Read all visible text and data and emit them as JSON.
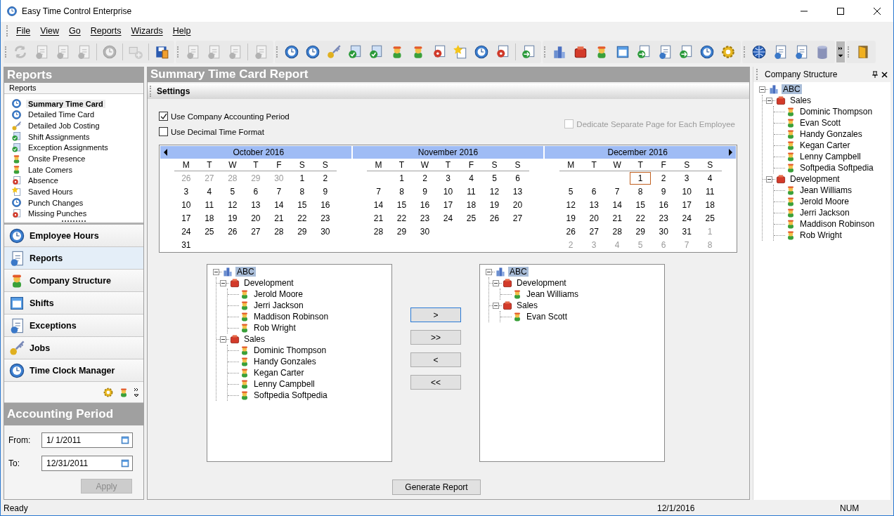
{
  "window": {
    "title": "Easy Time Control Enterprise"
  },
  "menu": [
    "File",
    "View",
    "Go",
    "Reports",
    "Wizards",
    "Help"
  ],
  "toolbar": {
    "groups": [
      {
        "sections": [
          {
            "buttons": [
              {
                "disabled": true
              },
              {
                "disabled": true
              },
              {
                "disabled": true
              },
              {
                "disabled": true
              }
            ]
          },
          {
            "buttons": [
              {
                "disabled": true
              }
            ]
          },
          {
            "buttons": [
              {
                "disabled": true
              }
            ]
          },
          {
            "buttons": [
              {
                "disabled": false
              }
            ]
          }
        ]
      },
      {
        "sections": [
          {
            "buttons": [
              {
                "disabled": true
              },
              {
                "disabled": true
              },
              {
                "disabled": true
              }
            ]
          },
          {
            "buttons": [
              {
                "disabled": true
              }
            ]
          }
        ]
      },
      {
        "sections": [
          {
            "buttons": [
              {
                "disabled": false
              },
              {
                "disabled": false
              },
              {
                "disabled": false
              },
              {
                "disabled": false
              },
              {
                "disabled": false
              },
              {
                "disabled": false
              },
              {
                "disabled": false
              },
              {
                "disabled": false
              },
              {
                "disabled": false
              },
              {
                "disabled": false
              },
              {
                "disabled": false
              }
            ]
          },
          {
            "buttons": [
              {
                "disabled": false
              }
            ]
          }
        ]
      },
      {
        "sections": [
          {
            "buttons": [
              {
                "disabled": false
              },
              {
                "disabled": false
              },
              {
                "disabled": false
              },
              {
                "disabled": false
              },
              {
                "disabled": false
              },
              {
                "disabled": false
              },
              {
                "disabled": false
              },
              {
                "disabled": false
              },
              {
                "disabled": false
              }
            ]
          }
        ]
      },
      {
        "sections": [
          {
            "buttons": [
              {
                "disabled": false
              },
              {
                "disabled": false
              },
              {
                "disabled": false
              },
              {
                "disabled": false
              }
            ]
          }
        ]
      }
    ]
  },
  "left_panel": {
    "title": "Reports",
    "subtitle": "Reports",
    "reports": [
      {
        "label": "Summary Time Card",
        "selected": true
      },
      {
        "label": "Detailed Time Card",
        "selected": false
      },
      {
        "label": "Detailed Job Costing",
        "selected": false
      },
      {
        "label": "Shift Assignments",
        "selected": false
      },
      {
        "label": "Exception Assignments",
        "selected": false
      },
      {
        "label": "Onsite Presence",
        "selected": false
      },
      {
        "label": "Late Comers",
        "selected": false
      },
      {
        "label": "Absence",
        "selected": false
      },
      {
        "label": "Saved Hours",
        "selected": false
      },
      {
        "label": "Punch Changes",
        "selected": false
      },
      {
        "label": "Missing Punches",
        "selected": false
      }
    ],
    "nav": [
      {
        "label": "Employee Hours",
        "selected": false
      },
      {
        "label": "Reports",
        "selected": true
      },
      {
        "label": "Company Structure",
        "selected": false
      },
      {
        "label": "Shifts",
        "selected": false
      },
      {
        "label": "Exceptions",
        "selected": false
      },
      {
        "label": "Jobs",
        "selected": false
      },
      {
        "label": "Time Clock Manager",
        "selected": false
      }
    ],
    "accounting_period": {
      "title": "Accounting Period",
      "from_label": "From:",
      "from": "1/  1/2011",
      "to_label": "To:",
      "to": "12/31/2011",
      "apply": {
        "label": "Apply",
        "disabled": true
      }
    }
  },
  "report": {
    "title": "Summary Time Card Report",
    "section": "Settings",
    "options": [
      {
        "label": "Use Company Accounting Period",
        "checked": true,
        "disabled": false
      },
      {
        "label": "Use Decimal Time Format",
        "checked": false,
        "disabled": false
      },
      {
        "label": "Dedicate Separate Page for Each Employee",
        "checked": false,
        "disabled": true
      }
    ],
    "calendar": [
      {
        "title": "October 2016",
        "weekdays": [
          "M",
          "T",
          "W",
          "T",
          "F",
          "S",
          "S"
        ],
        "weeks": [
          [
            {
              "day": "26",
              "muted": true,
              "today": false
            },
            {
              "day": "27",
              "muted": true,
              "today": false
            },
            {
              "day": "28",
              "muted": true,
              "today": false
            },
            {
              "day": "29",
              "muted": true,
              "today": false
            },
            {
              "day": "30",
              "muted": true,
              "today": false
            },
            {
              "day": "1",
              "muted": false,
              "today": false
            },
            {
              "day": "2",
              "muted": false,
              "today": false
            }
          ],
          [
            {
              "day": "3",
              "muted": false,
              "today": false
            },
            {
              "day": "4",
              "muted": false,
              "today": false
            },
            {
              "day": "5",
              "muted": false,
              "today": false
            },
            {
              "day": "6",
              "muted": false,
              "today": false
            },
            {
              "day": "7",
              "muted": false,
              "today": false
            },
            {
              "day": "8",
              "muted": false,
              "today": false
            },
            {
              "day": "9",
              "muted": false,
              "today": false
            }
          ],
          [
            {
              "day": "10",
              "muted": false,
              "today": false
            },
            {
              "day": "11",
              "muted": false,
              "today": false
            },
            {
              "day": "12",
              "muted": false,
              "today": false
            },
            {
              "day": "13",
              "muted": false,
              "today": false
            },
            {
              "day": "14",
              "muted": false,
              "today": false
            },
            {
              "day": "15",
              "muted": false,
              "today": false
            },
            {
              "day": "16",
              "muted": false,
              "today": false
            }
          ],
          [
            {
              "day": "17",
              "muted": false,
              "today": false
            },
            {
              "day": "18",
              "muted": false,
              "today": false
            },
            {
              "day": "19",
              "muted": false,
              "today": false
            },
            {
              "day": "20",
              "muted": false,
              "today": false
            },
            {
              "day": "21",
              "muted": false,
              "today": false
            },
            {
              "day": "22",
              "muted": false,
              "today": false
            },
            {
              "day": "23",
              "muted": false,
              "today": false
            }
          ],
          [
            {
              "day": "24",
              "muted": false,
              "today": false
            },
            {
              "day": "25",
              "muted": false,
              "today": false
            },
            {
              "day": "26",
              "muted": false,
              "today": false
            },
            {
              "day": "27",
              "muted": false,
              "today": false
            },
            {
              "day": "28",
              "muted": false,
              "today": false
            },
            {
              "day": "29",
              "muted": false,
              "today": false
            },
            {
              "day": "30",
              "muted": false,
              "today": false
            }
          ],
          [
            {
              "day": "31",
              "muted": false,
              "today": false
            }
          ]
        ]
      },
      {
        "title": "November 2016",
        "weekdays": [
          "M",
          "T",
          "W",
          "T",
          "F",
          "S",
          "S"
        ],
        "weeks": [
          [
            {
              "day": "1",
              "muted": false,
              "today": false
            },
            {
              "day": "2",
              "muted": false,
              "today": false
            },
            {
              "day": "3",
              "muted": false,
              "today": false
            },
            {
              "day": "4",
              "muted": false,
              "today": false
            },
            {
              "day": "5",
              "muted": false,
              "today": false
            },
            {
              "day": "6",
              "muted": false,
              "today": false
            }
          ],
          [
            {
              "day": "7",
              "muted": false,
              "today": false
            },
            {
              "day": "8",
              "muted": false,
              "today": false
            },
            {
              "day": "9",
              "muted": false,
              "today": false
            },
            {
              "day": "10",
              "muted": false,
              "today": false
            },
            {
              "day": "11",
              "muted": false,
              "today": false
            },
            {
              "day": "12",
              "muted": false,
              "today": false
            },
            {
              "day": "13",
              "muted": false,
              "today": false
            }
          ],
          [
            {
              "day": "14",
              "muted": false,
              "today": false
            },
            {
              "day": "15",
              "muted": false,
              "today": false
            },
            {
              "day": "16",
              "muted": false,
              "today": false
            },
            {
              "day": "17",
              "muted": false,
              "today": false
            },
            {
              "day": "18",
              "muted": false,
              "today": false
            },
            {
              "day": "19",
              "muted": false,
              "today": false
            },
            {
              "day": "20",
              "muted": false,
              "today": false
            }
          ],
          [
            {
              "day": "21",
              "muted": false,
              "today": false
            },
            {
              "day": "22",
              "muted": false,
              "today": false
            },
            {
              "day": "23",
              "muted": false,
              "today": false
            },
            {
              "day": "24",
              "muted": false,
              "today": false
            },
            {
              "day": "25",
              "muted": false,
              "today": false
            },
            {
              "day": "26",
              "muted": false,
              "today": false
            },
            {
              "day": "27",
              "muted": false,
              "today": false
            }
          ],
          [
            {
              "day": "28",
              "muted": false,
              "today": false
            },
            {
              "day": "29",
              "muted": false,
              "today": false
            },
            {
              "day": "30",
              "muted": false,
              "today": false
            }
          ]
        ]
      },
      {
        "title": "December 2016",
        "weekdays": [
          "M",
          "T",
          "W",
          "T",
          "F",
          "S",
          "S"
        ],
        "weeks": [
          [
            {
              "day": "1",
              "muted": false,
              "today": true
            },
            {
              "day": "2",
              "muted": false,
              "today": false
            },
            {
              "day": "3",
              "muted": false,
              "today": false
            },
            {
              "day": "4",
              "muted": false,
              "today": false
            }
          ],
          [
            {
              "day": "5",
              "muted": false,
              "today": false
            },
            {
              "day": "6",
              "muted": false,
              "today": false
            },
            {
              "day": "7",
              "muted": false,
              "today": false
            },
            {
              "day": "8",
              "muted": false,
              "today": false
            },
            {
              "day": "9",
              "muted": false,
              "today": false
            },
            {
              "day": "10",
              "muted": false,
              "today": false
            },
            {
              "day": "11",
              "muted": false,
              "today": false
            }
          ],
          [
            {
              "day": "12",
              "muted": false,
              "today": false
            },
            {
              "day": "13",
              "muted": false,
              "today": false
            },
            {
              "day": "14",
              "muted": false,
              "today": false
            },
            {
              "day": "15",
              "muted": false,
              "today": false
            },
            {
              "day": "16",
              "muted": false,
              "today": false
            },
            {
              "day": "17",
              "muted": false,
              "today": false
            },
            {
              "day": "18",
              "muted": false,
              "today": false
            }
          ],
          [
            {
              "day": "19",
              "muted": false,
              "today": false
            },
            {
              "day": "20",
              "muted": false,
              "today": false
            },
            {
              "day": "21",
              "muted": false,
              "today": false
            },
            {
              "day": "22",
              "muted": false,
              "today": false
            },
            {
              "day": "23",
              "muted": false,
              "today": false
            },
            {
              "day": "24",
              "muted": false,
              "today": false
            },
            {
              "day": "25",
              "muted": false,
              "today": false
            }
          ],
          [
            {
              "day": "26",
              "muted": false,
              "today": false
            },
            {
              "day": "27",
              "muted": false,
              "today": false
            },
            {
              "day": "28",
              "muted": false,
              "today": false
            },
            {
              "day": "29",
              "muted": false,
              "today": false
            },
            {
              "day": "30",
              "muted": false,
              "today": false
            },
            {
              "day": "31",
              "muted": false,
              "today": false
            },
            {
              "day": "1",
              "muted": true,
              "today": false
            }
          ],
          [
            {
              "day": "2",
              "muted": true,
              "today": false
            },
            {
              "day": "3",
              "muted": true,
              "today": false
            },
            {
              "day": "4",
              "muted": true,
              "today": false
            },
            {
              "day": "5",
              "muted": true,
              "today": false
            },
            {
              "day": "6",
              "muted": true,
              "today": false
            },
            {
              "day": "7",
              "muted": true,
              "today": false
            },
            {
              "day": "8",
              "muted": true,
              "today": false
            }
          ]
        ]
      }
    ],
    "available_tree": [
      {
        "label": "ABC",
        "kind": "company",
        "selected": true,
        "expanded": true,
        "children": [
          {
            "label": "Development",
            "kind": "department",
            "selected": false,
            "expanded": true,
            "children": [
              {
                "label": "Jerold Moore",
                "kind": "employee",
                "selected": false
              },
              {
                "label": "Jerri Jackson",
                "kind": "employee",
                "selected": false
              },
              {
                "label": "Maddison Robinson",
                "kind": "employee",
                "selected": false
              },
              {
                "label": "Rob Wright",
                "kind": "employee",
                "selected": false
              }
            ]
          },
          {
            "label": "Sales",
            "kind": "department",
            "selected": false,
            "expanded": true,
            "children": [
              {
                "label": "Dominic Thompson",
                "kind": "employee",
                "selected": false
              },
              {
                "label": "Handy Gonzales",
                "kind": "employee",
                "selected": false
              },
              {
                "label": "Kegan Carter",
                "kind": "employee",
                "selected": false
              },
              {
                "label": "Lenny Campbell",
                "kind": "employee",
                "selected": false
              },
              {
                "label": "Softpedia Softpedia",
                "kind": "employee",
                "selected": false
              }
            ]
          }
        ]
      }
    ],
    "transfer_buttons": [
      ">",
      ">>",
      "<",
      "<<"
    ],
    "selected_tree": [
      {
        "label": "ABC",
        "kind": "company",
        "selected": true,
        "expanded": true,
        "children": [
          {
            "label": "Development",
            "kind": "department",
            "selected": false,
            "expanded": true,
            "children": [
              {
                "label": "Jean Williams",
                "kind": "employee",
                "selected": false
              }
            ]
          },
          {
            "label": "Sales",
            "kind": "department",
            "selected": false,
            "expanded": true,
            "children": [
              {
                "label": "Evan Scott",
                "kind": "employee",
                "selected": false
              }
            ]
          }
        ]
      }
    ],
    "generate_button": "Generate Report"
  },
  "company_structure": {
    "title": "Company Structure",
    "tree": [
      {
        "label": "ABC",
        "kind": "company",
        "selected": true,
        "expanded": true,
        "children": [
          {
            "label": "Sales",
            "kind": "department",
            "selected": false,
            "expanded": true,
            "children": [
              {
                "label": "Dominic Thompson",
                "kind": "employee",
                "selected": false
              },
              {
                "label": "Evan Scott",
                "kind": "employee",
                "selected": false
              },
              {
                "label": "Handy Gonzales",
                "kind": "employee",
                "selected": false
              },
              {
                "label": "Kegan Carter",
                "kind": "employee",
                "selected": false
              },
              {
                "label": "Lenny Campbell",
                "kind": "employee",
                "selected": false
              },
              {
                "label": "Softpedia Softpedia",
                "kind": "employee",
                "selected": false
              }
            ]
          },
          {
            "label": "Development",
            "kind": "department",
            "selected": false,
            "expanded": true,
            "children": [
              {
                "label": "Jean Williams",
                "kind": "employee",
                "selected": false
              },
              {
                "label": "Jerold Moore",
                "kind": "employee",
                "selected": false
              },
              {
                "label": "Jerri Jackson",
                "kind": "employee",
                "selected": false
              },
              {
                "label": "Maddison Robinson",
                "kind": "employee",
                "selected": false
              },
              {
                "label": "Rob Wright",
                "kind": "employee",
                "selected": false
              }
            ]
          }
        ]
      }
    ]
  },
  "status_bar": [
    "Ready",
    "12/1/2016",
    "NUM"
  ]
}
